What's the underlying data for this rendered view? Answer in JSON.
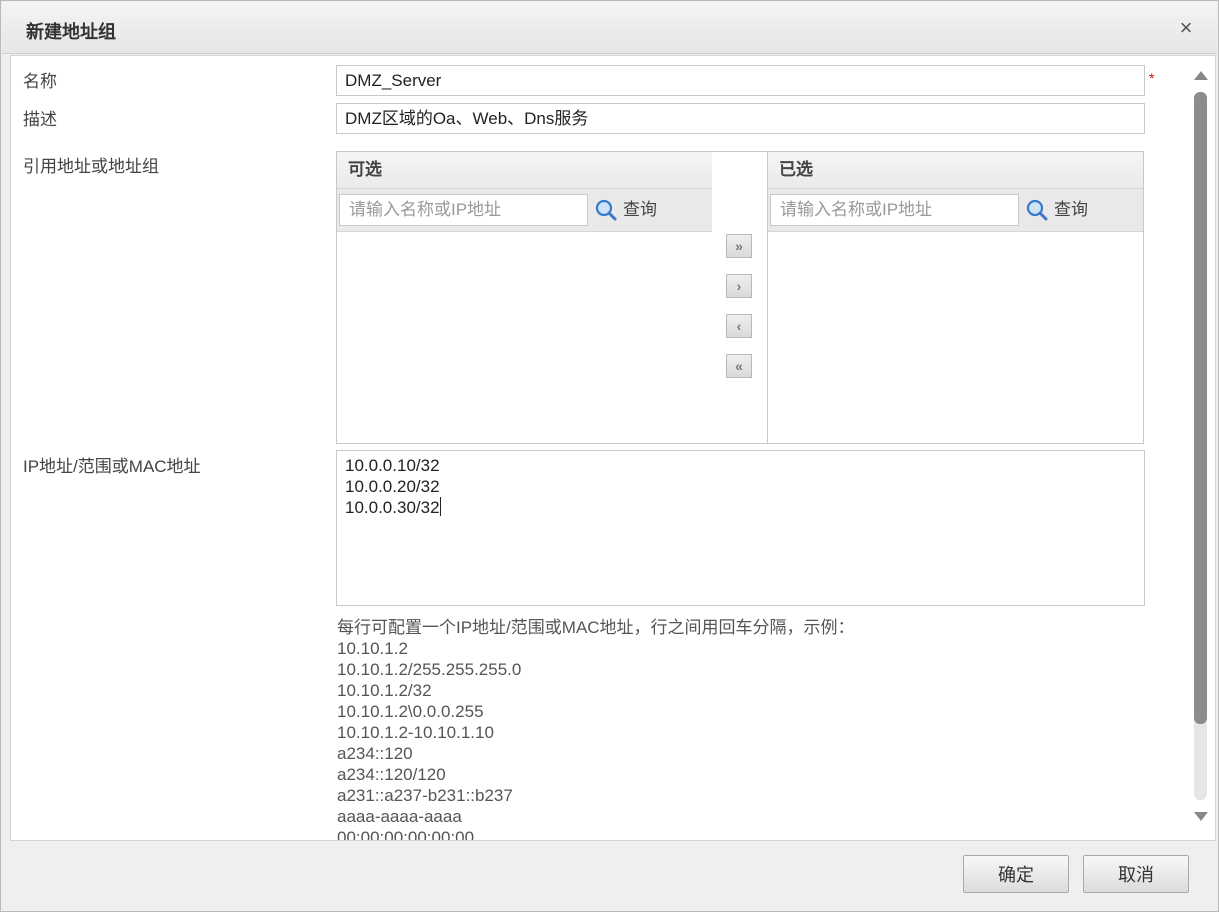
{
  "dialog": {
    "title": "新建地址组",
    "close_icon": "close-icon",
    "close_glyph": "×"
  },
  "form": {
    "name": {
      "label": "名称",
      "value": "DMZ_Server",
      "required_mark": "*"
    },
    "description": {
      "label": "描述",
      "value": "DMZ区域的Oa、Web、Dns服务"
    },
    "reference": {
      "label": "引用地址或地址组",
      "available": {
        "header": "可选",
        "search_placeholder": "请输入名称或IP地址",
        "search_button": "查询",
        "items": []
      },
      "selected": {
        "header": "已选",
        "search_placeholder": "请输入名称或IP地址",
        "search_button": "查询",
        "items": []
      },
      "transfer_buttons": {
        "move_all_right": "»",
        "move_right": "›",
        "move_left": "‹",
        "move_all_left": "«"
      }
    },
    "addresses": {
      "label": "IP地址/范围或MAC地址",
      "lines": [
        "10.0.0.10/32",
        "10.0.0.20/32",
        "10.0.0.30/32"
      ]
    },
    "hint": {
      "intro": "每行可配置一个IP地址/范围或MAC地址，行之间用回车分隔，示例：",
      "examples": [
        "10.10.1.2",
        "10.10.1.2/255.255.255.0",
        "10.10.1.2/32",
        "10.10.1.2\\0.0.0.255",
        "10.10.1.2-10.10.1.10",
        "a234::120",
        "a234::120/120",
        "a231::a237-b231::b237",
        "aaaa-aaaa-aaaa",
        "00:00:00:00:00:00"
      ]
    }
  },
  "footer": {
    "confirm": "确定",
    "cancel": "取消"
  },
  "colors": {
    "required": "#d01010",
    "scroll_thumb": "#8c8c8c",
    "search_icon": "#3a78c9"
  }
}
